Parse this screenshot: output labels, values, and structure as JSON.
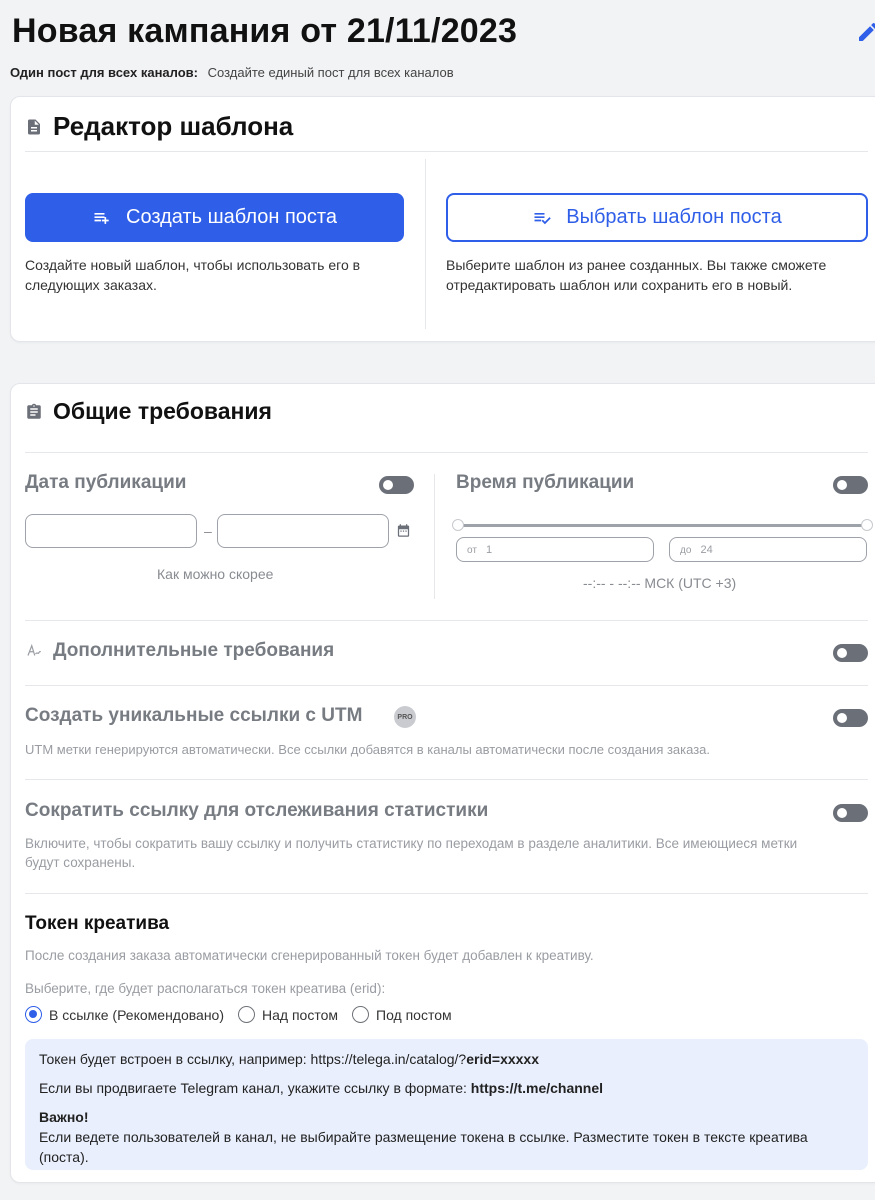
{
  "page": {
    "title": "Новая кампания от 21/11/2023",
    "subtitle_label": "Один пост для всех каналов:",
    "subtitle_value": "Создайте единый пост для всех каналов"
  },
  "colors": {
    "accent": "#2f5ee8",
    "toggle_off": "#6b6f78",
    "info_bg": "#e9effc"
  },
  "template_editor": {
    "title": "Редактор шаблона",
    "icon": "document-icon",
    "create_button": "Создать шаблон поста",
    "create_desc_1": "Создайте новый шаблон, чтобы использовать его в",
    "create_desc_2": "следующих заказах.",
    "choose_button": "Выбрать шаблон поста",
    "choose_desc_1": "Выберите шаблон из ранее созданных. Вы также сможете",
    "choose_desc_2": "отредактировать шаблон или сохранить его в новый."
  },
  "requirements": {
    "title": "Общие требования",
    "icon": "clipboard-icon",
    "date": {
      "label": "Дата публикации",
      "separator": "–",
      "hint": "Как можно скорее",
      "enabled": false
    },
    "time": {
      "label": "Время публикации",
      "from_prefix": "от",
      "from_value": "1",
      "to_prefix": "до",
      "to_value": "24",
      "range_min": 1,
      "range_max": 24,
      "tz_text": "--:-- - --:-- МСК (UTC +3)",
      "enabled": false
    },
    "additional": {
      "label": "Дополнительные требования",
      "enabled": false
    },
    "utm": {
      "label": "Создать уникальные ссылки с UTM",
      "badge": "PRO",
      "desc": "UTM метки генерируются автоматически. Все ссылки добавятся в каналы автоматически после создания заказа.",
      "enabled": false
    },
    "shorten": {
      "label": "Сократить ссылку для отслеживания статистики",
      "desc_1": "Включите, чтобы сократить вашу ссылку и получить статистику по переходам в разделе аналитики. Все имеющиеся метки",
      "desc_2": "будут сохранены.",
      "enabled": false
    },
    "token": {
      "title": "Токен креатива",
      "desc": "После создания заказа автоматически сгенерированный токен будет добавлен к креативу.",
      "question": "Выберите, где будет располагаться токен креатива (erid):",
      "options": [
        "В ссылке (Рекомендовано)",
        "Над постом",
        "Под постом"
      ],
      "selected": "В ссылке (Рекомендовано)",
      "info_line1_text": "Токен будет встроен в ссылку, например: https://telega.in/catalog/?",
      "info_line1_bold": "erid=xxxxx",
      "info_line2_text": "Если вы продвигаете Telegram канал, укажите ссылку в формате: ",
      "info_line2_bold": "https://t.me/channel",
      "important_title": "Важно!",
      "important_text": "Если ведете пользователей в канал, не выбирайте размещение токена в ссылке. Разместите токен в тексте креатива (поста)."
    }
  }
}
